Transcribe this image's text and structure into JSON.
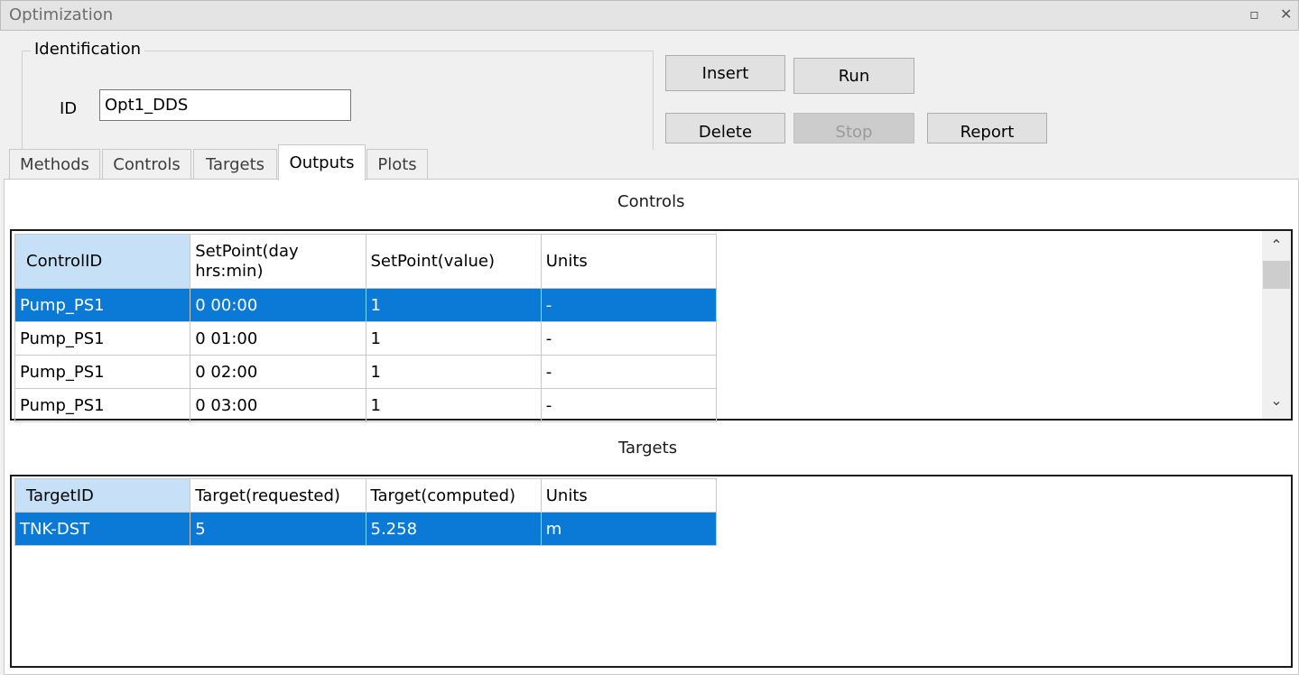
{
  "window": {
    "title": "Optimization",
    "maximize_icon": "maximize-icon",
    "close_icon": "close-icon",
    "maximize_glyph": "▫",
    "close_glyph": "✕"
  },
  "identification": {
    "legend": "Identification",
    "id_label": "ID",
    "id_value": "Opt1_DDS"
  },
  "buttons": {
    "insert": "Insert",
    "run": "Run",
    "delete": "Delete",
    "stop": "Stop",
    "report": "Report"
  },
  "tabs": [
    {
      "label": "Methods"
    },
    {
      "label": "Controls"
    },
    {
      "label": "Targets"
    },
    {
      "label": "Outputs",
      "active": true
    },
    {
      "label": "Plots"
    }
  ],
  "controls_section": {
    "title": "Controls",
    "columns": [
      "ControlID",
      "SetPoint(day hrs:min)",
      "SetPoint(value)",
      "Units"
    ],
    "rows": [
      [
        "Pump_PS1",
        "0 00:00",
        "1",
        "-"
      ],
      [
        "Pump_PS1",
        "0 01:00",
        "1",
        "-"
      ],
      [
        "Pump_PS1",
        "0 02:00",
        "1",
        "-"
      ],
      [
        "Pump_PS1",
        "0 03:00",
        "1",
        "-"
      ]
    ],
    "selected_row": 0
  },
  "targets_section": {
    "title": "Targets",
    "columns": [
      "TargetID",
      "Target(requested)",
      "Target(computed)",
      "Units"
    ],
    "rows": [
      [
        "TNK-DST",
        "5",
        "5.258",
        "m"
      ]
    ],
    "selected_row": 0
  },
  "scrollbar": {
    "up_glyph": "⌃",
    "down_glyph": "⌄"
  },
  "colors": {
    "selection": "#0a7ad6",
    "header_selected": "#c6e1f7"
  }
}
